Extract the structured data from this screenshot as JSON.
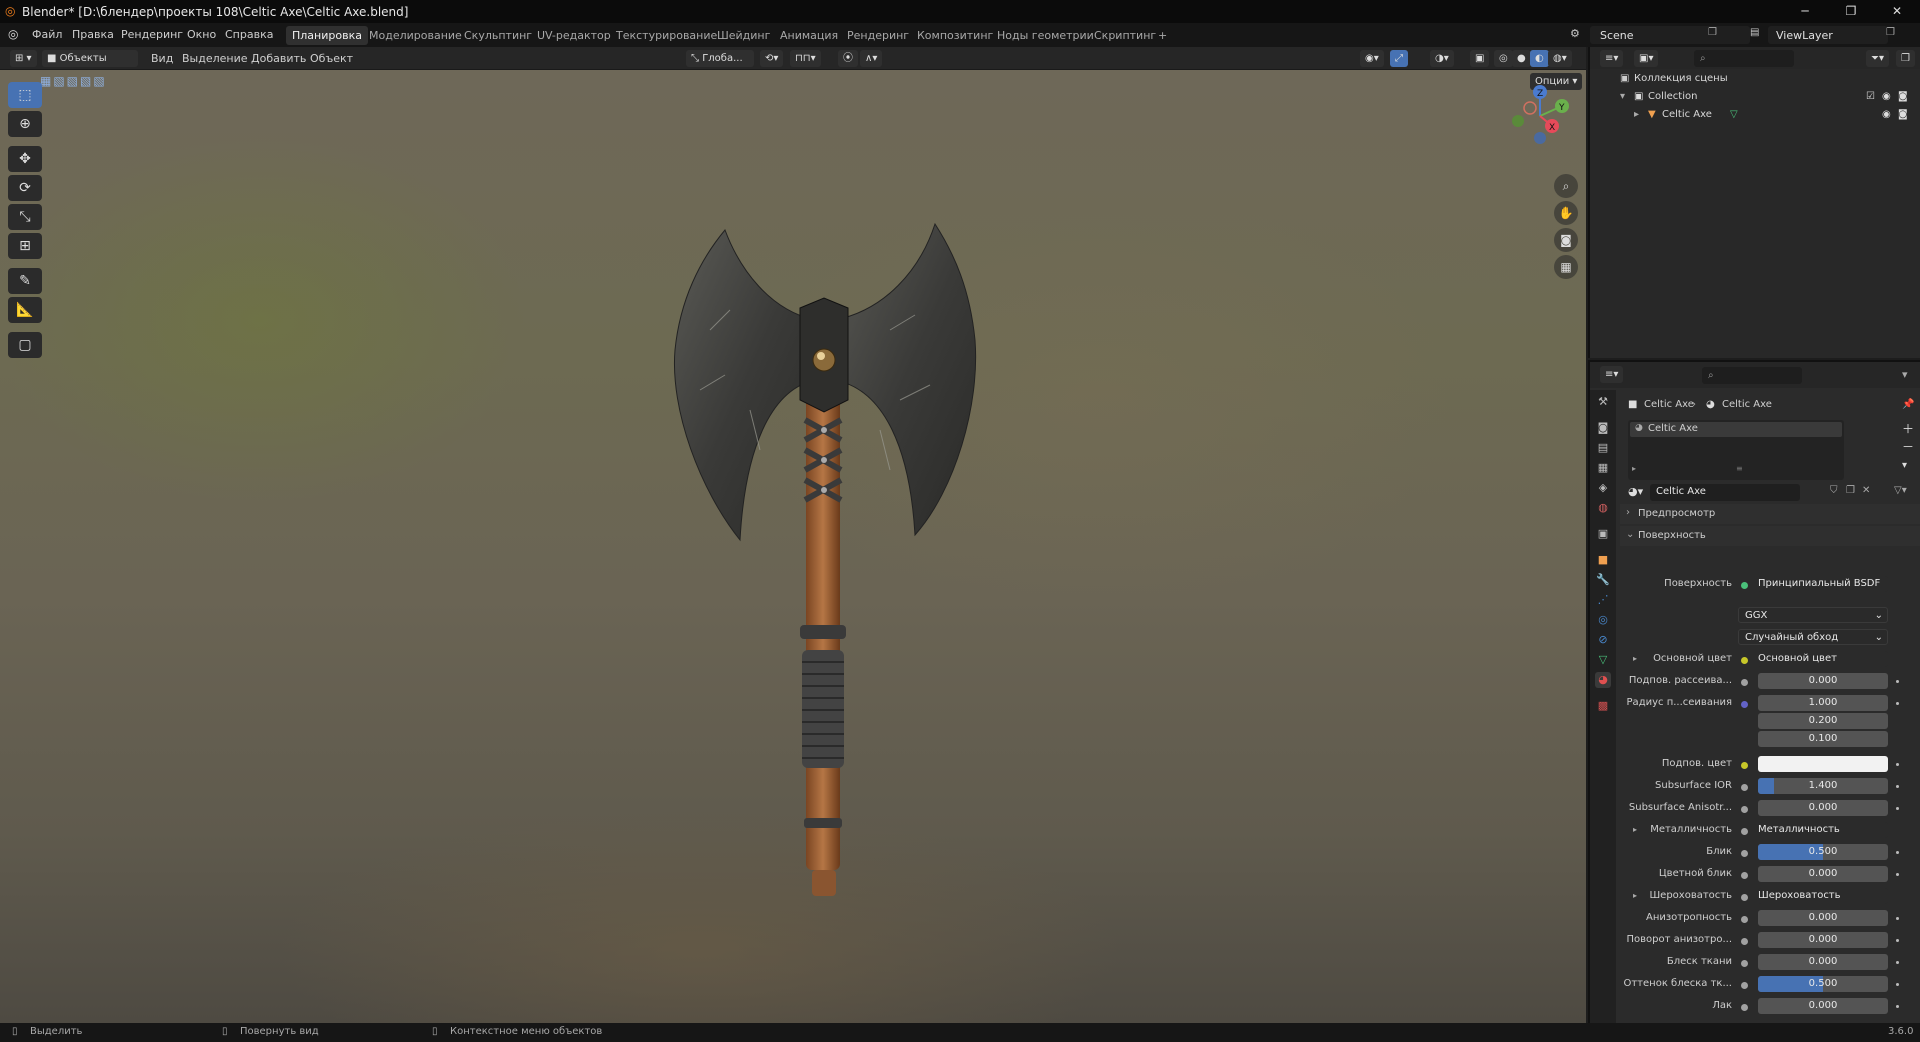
{
  "titlebar": {
    "title": "Blender* [D:\\блендер\\проекты 108\\Celtic Axe\\Celtic Axe.blend]"
  },
  "menu": {
    "items": [
      "Файл",
      "Правка",
      "Рендеринг",
      "Окно",
      "Справка"
    ]
  },
  "workspaces": [
    "Планировка",
    "Моделирование",
    "Скульптинг",
    "UV-редактор",
    "Текстурирование",
    "Шейдинг",
    "Анимация",
    "Рендеринг",
    "Композитинг",
    "Ноды геометрии",
    "Скриптинг"
  ],
  "active_workspace": "Планировка",
  "scene": {
    "label": "Scene",
    "view_layer": "ViewLayer"
  },
  "viewport_header": {
    "mode": "Объекты",
    "menus": [
      "Вид",
      "Выделение",
      "Добавить",
      "Объект"
    ],
    "orientation": "Глоба...",
    "options": "Опции"
  },
  "gizmo": {
    "x": "X",
    "y": "Y",
    "z": "Z"
  },
  "outliner": {
    "root": "Коллекция сцены",
    "collection": "Collection",
    "object": "Celtic Axe"
  },
  "properties": {
    "breadcrumb_object": "Celtic Axe",
    "breadcrumb_material": "Celtic Axe",
    "slot": "Celtic Axe",
    "material_name": "Celtic Axe",
    "preview_panel": "Предпросмотр",
    "surface_panel": "Поверхность",
    "surface_label": "Поверхность",
    "surface_value": "Принципиальный BSDF",
    "distribution": "GGX",
    "subsurface_method": "Случайный обход",
    "rows": {
      "base_color": {
        "label": "Основной цвет",
        "value": "Основной цвет"
      },
      "subsurface": {
        "label": "Подпов. рассеива...",
        "value": "0.000"
      },
      "subsurface_radius": {
        "label": "Радиус п...сеивания",
        "v1": "1.000",
        "v2": "0.200",
        "v3": "0.100"
      },
      "subsurface_color": {
        "label": "Подпов. цвет"
      },
      "subsurface_ior": {
        "label": "Subsurface IOR",
        "value": "1.400",
        "fill": 0.12
      },
      "subsurface_aniso": {
        "label": "Subsurface Anisotr...",
        "value": "0.000"
      },
      "metallic": {
        "label": "Металличность",
        "value": "Металличность"
      },
      "specular": {
        "label": "Блик",
        "value": "0.500",
        "fill": 0.5
      },
      "specular_tint": {
        "label": "Цветной блик",
        "value": "0.000"
      },
      "roughness": {
        "label": "Шероховатость",
        "value": "Шероховатость"
      },
      "anisotropic": {
        "label": "Анизотропность",
        "value": "0.000"
      },
      "aniso_rotation": {
        "label": "Поворот анизотро...",
        "value": "0.000"
      },
      "sheen": {
        "label": "Блеск ткани",
        "value": "0.000"
      },
      "sheen_tint": {
        "label": "Оттенок блеска тк...",
        "value": "0.500",
        "fill": 0.5
      },
      "clearcoat": {
        "label": "Лак",
        "value": "0.000"
      }
    }
  },
  "statusbar": {
    "select": "Выделить",
    "rotate": "Повернуть вид",
    "context": "Контекстное меню объектов",
    "version": "3.6.0"
  },
  "colors": {
    "accent": "#4772b3",
    "bg": "#1d1d1d"
  }
}
